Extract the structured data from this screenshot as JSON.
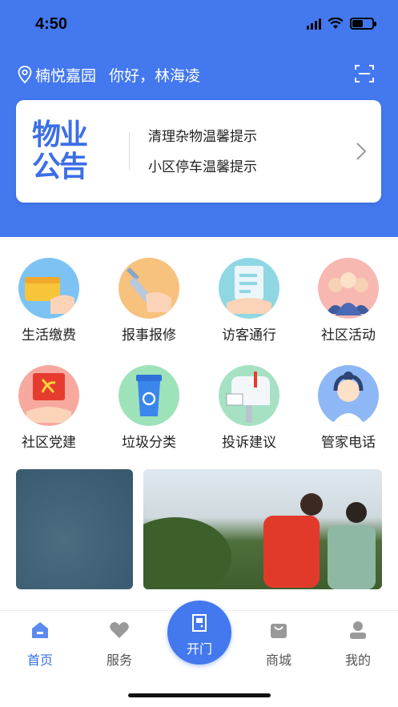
{
  "status": {
    "time": "4:50"
  },
  "header": {
    "community": "楠悦嘉园",
    "greeting": "你好，林海凌"
  },
  "notice": {
    "logo_line1": "物业",
    "logo_line2": "公告",
    "items": [
      "清理杂物温馨提示",
      "小区停车温馨提示"
    ]
  },
  "grid": [
    {
      "label": "生活缴费",
      "icon": "wallet-icon"
    },
    {
      "label": "报事报修",
      "icon": "wrench-icon"
    },
    {
      "label": "访客通行",
      "icon": "visitor-pass-icon"
    },
    {
      "label": "社区活动",
      "icon": "people-icon"
    },
    {
      "label": "社区党建",
      "icon": "party-emblem-icon"
    },
    {
      "label": "垃圾分类",
      "icon": "recycle-bin-icon"
    },
    {
      "label": "投诉建议",
      "icon": "mailbox-icon"
    },
    {
      "label": "管家电话",
      "icon": "headset-agent-icon"
    }
  ],
  "tabs": [
    {
      "label": "首页",
      "icon": "home-icon",
      "active": true
    },
    {
      "label": "服务",
      "icon": "heart-icon"
    },
    {
      "label": "开门",
      "icon": "door-icon"
    },
    {
      "label": "商城",
      "icon": "shopping-bag-icon"
    },
    {
      "label": "我的",
      "icon": "user-icon"
    }
  ],
  "colors": {
    "primary": "#4378EE",
    "accent_text": "#3C6FE6"
  }
}
